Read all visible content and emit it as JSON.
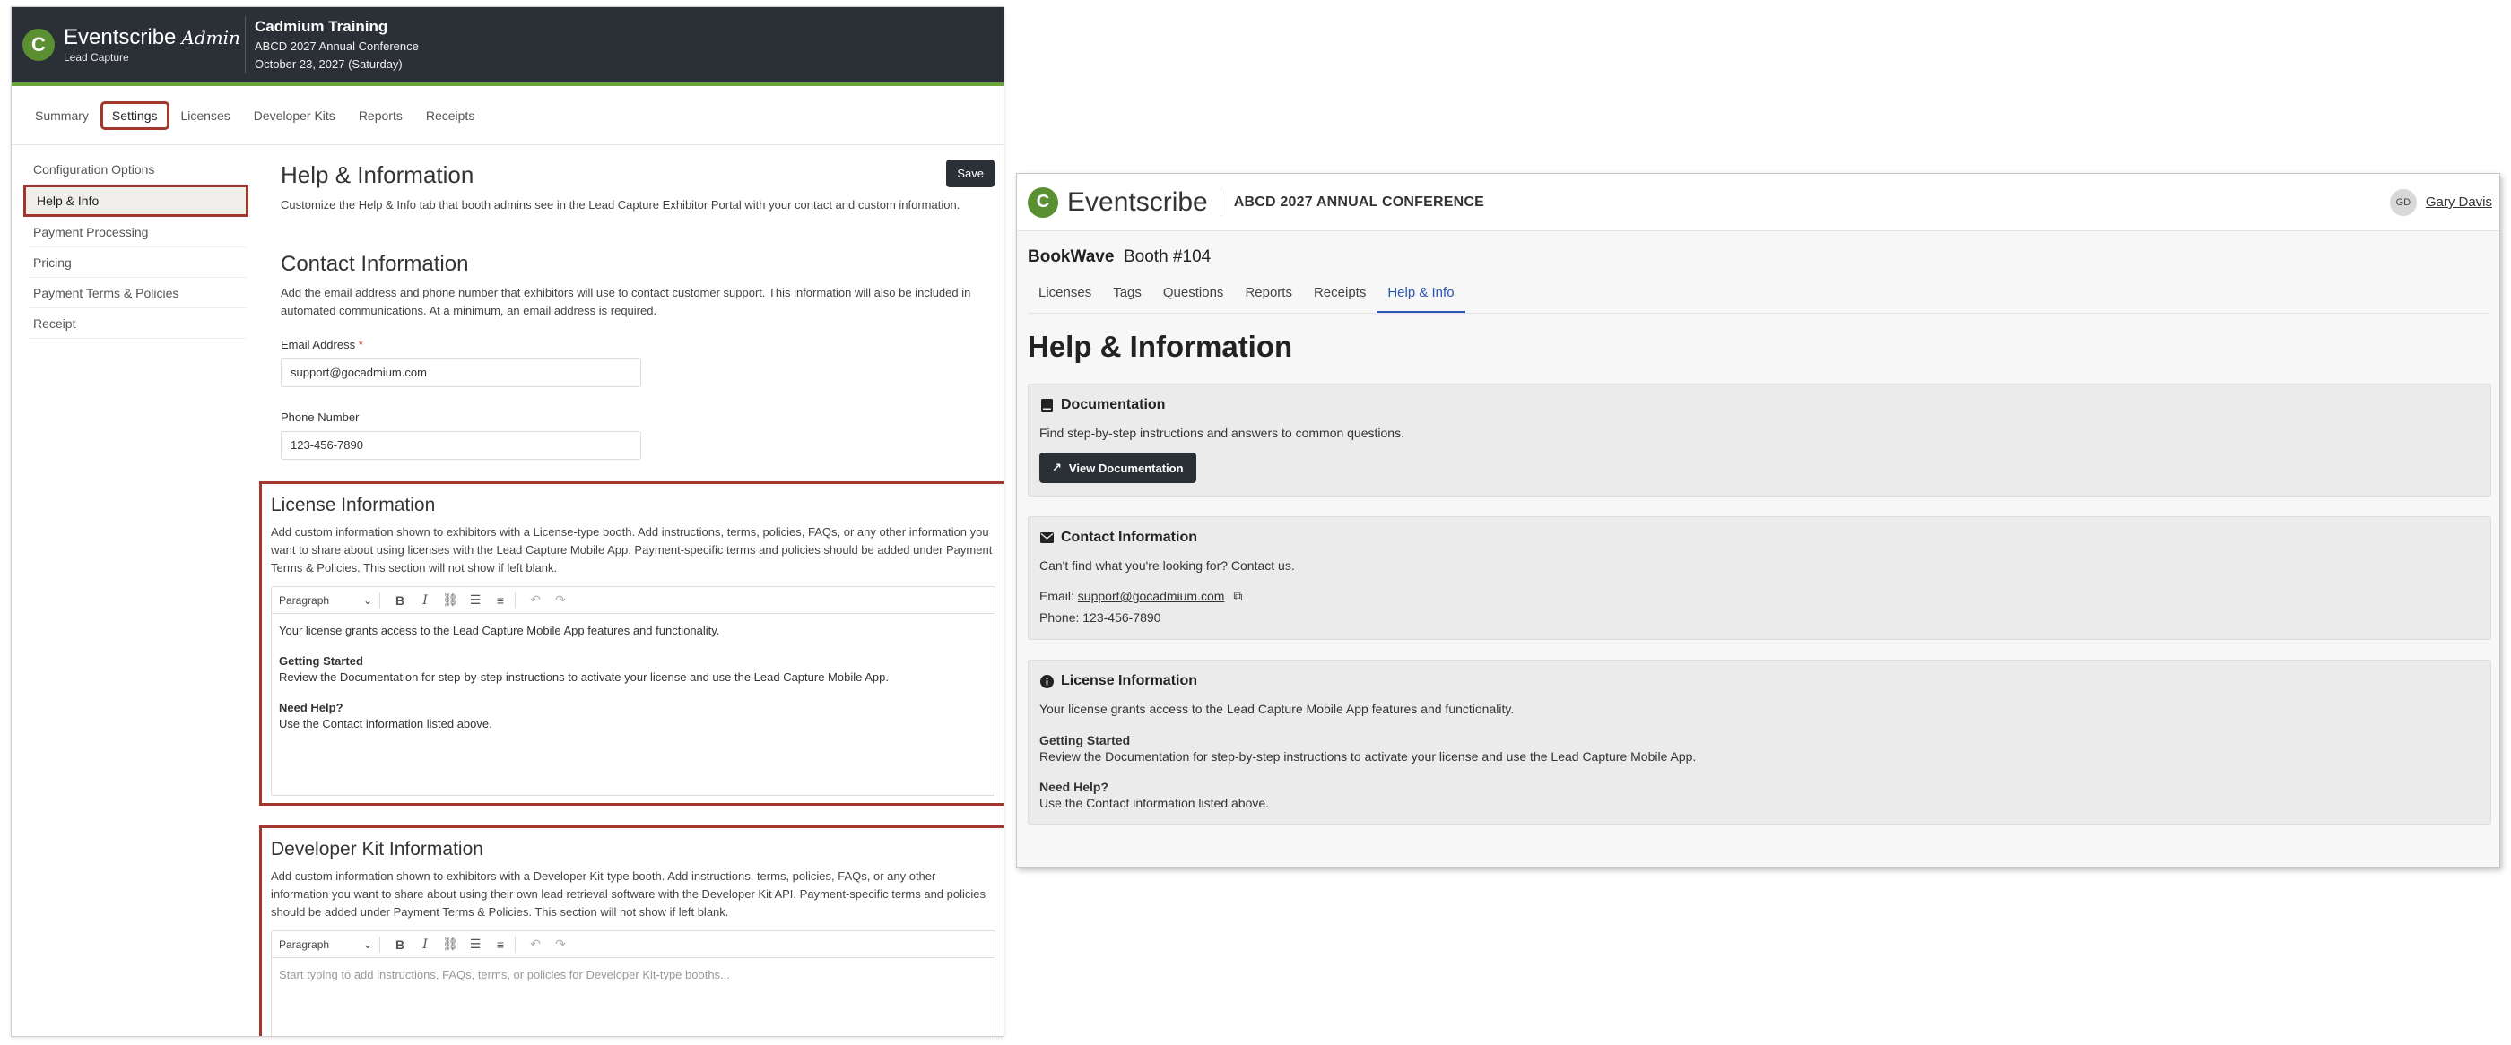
{
  "admin": {
    "brand": {
      "name": "Eventscribe",
      "admin_label": "Admin",
      "subtitle": "Lead Capture",
      "logo_letter": "C"
    },
    "event": {
      "title": "Cadmium Training",
      "conference": "ABCD 2027 Annual Conference",
      "date": "October 23, 2027 (Saturday)"
    },
    "tabs": [
      "Summary",
      "Settings",
      "Licenses",
      "Developer Kits",
      "Reports",
      "Receipts"
    ],
    "active_tab": "Settings",
    "sidebar": [
      "Configuration Options",
      "Help & Info",
      "Payment Processing",
      "Pricing",
      "Payment Terms & Policies",
      "Receipt"
    ],
    "active_sidebar": "Help & Info",
    "help": {
      "title": "Help & Information",
      "desc": "Customize the Help & Info tab that booth admins see in the Lead Capture Exhibitor Portal with your contact and custom information.",
      "save_label": "Save"
    },
    "contact": {
      "title": "Contact Information",
      "desc": "Add the email address and phone number that exhibitors will use to contact customer support. This information will also be included in automated communications. At a minimum, an email address is required.",
      "email_label": "Email Address",
      "email_required": "*",
      "email_value": "support@gocadmium.com",
      "phone_label": "Phone Number",
      "phone_value": "123-456-7890"
    },
    "license": {
      "title": "License Information",
      "desc": "Add custom information shown to exhibitors with a License-type booth. Add instructions, terms, policies, FAQs, or any other information you want to share about using licenses with the Lead Capture Mobile App. Payment-specific terms and policies should be added under Payment Terms & Policies. This section will not show if left blank.",
      "toolbar_select": "Paragraph",
      "intro": "Your license grants access to the Lead Capture Mobile App features and functionality.",
      "h1": "Getting Started",
      "p1": "Review the Documentation for step-by-step instructions to activate your license and use the Lead Capture Mobile App.",
      "h2": "Need Help?",
      "p2": "Use the Contact information listed above."
    },
    "devkit": {
      "title": "Developer Kit Information",
      "desc": "Add custom information shown to exhibitors with a Developer Kit-type booth. Add instructions, terms, policies, FAQs, or any other information you want to share about using their own lead retrieval software with the Developer Kit API. Payment-specific terms and policies should be added under Payment Terms & Policies. This section will not show if left blank.",
      "toolbar_select": "Paragraph",
      "placeholder": "Start typing to add instructions, FAQs, terms, or policies for Developer Kit-type booths..."
    }
  },
  "portal": {
    "brand": "Eventscribe",
    "logo_letter": "C",
    "event": "ABCD 2027 ANNUAL CONFERENCE",
    "user_initials": "GD",
    "user_name": "Gary Davis",
    "booth_name": "BookWave",
    "booth_number": "Booth #104",
    "tabs": [
      "Licenses",
      "Tags",
      "Questions",
      "Reports",
      "Receipts",
      "Help & Info"
    ],
    "active_tab": "Help & Info",
    "title": "Help & Information",
    "documentation": {
      "title": "Documentation",
      "text": "Find step-by-step instructions and answers to common questions.",
      "button": "View Documentation"
    },
    "contact": {
      "title": "Contact Information",
      "text": "Can't find what you're looking for? Contact us.",
      "email_prefix": "Email:",
      "email": "support@gocadmium.com",
      "phone": "Phone: 123-456-7890"
    },
    "license": {
      "title": "License Information",
      "intro": "Your license grants access to the Lead Capture Mobile App features and functionality.",
      "h1": "Getting Started",
      "p1": "Review the Documentation for step-by-step instructions to activate your license and use the Lead Capture Mobile App.",
      "h2": "Need Help?",
      "p2": "Use the Contact information listed above."
    }
  },
  "colors": {
    "accent_green": "#6ba539",
    "logo_green": "#5a8f32",
    "highlight_red": "#a2372c",
    "dark": "#2b2f36",
    "link_blue": "#2c56b3"
  }
}
